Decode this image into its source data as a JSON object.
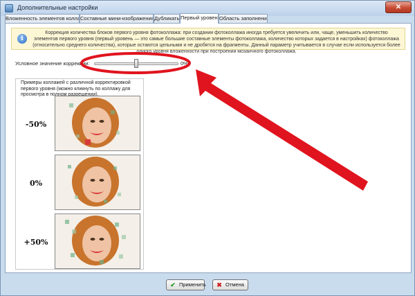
{
  "window": {
    "title": "Дополнительные настройки",
    "close_glyph": "✕"
  },
  "tabs": [
    {
      "label": "Вложенность элементов коллажа",
      "active": false
    },
    {
      "label": "Составные мини-изображения",
      "active": false
    },
    {
      "label": "Дубликаты",
      "active": false
    },
    {
      "label": "Первый уровень",
      "active": true
    },
    {
      "label": "Область заполнения",
      "active": false
    }
  ],
  "info": {
    "icon": "info-icon",
    "text": "Коррекция количества блоков первого уровня фотоколлажа: при создании фотоколлажа иногда требуется увеличить или, чаще, уменьшить количество элементов первого уровня (первый уровень — это самые большие составные элементы фотоколлажа, количество которых задается в настройках) фотоколлажа (относительно среднего количества), которые остаются цельными и не дробятся на фрагменты. Данный параметр учитывается в случае если используется более одного уровня вложенности при построении мозаичного фотоколлажа."
  },
  "slider": {
    "label": "Условное значение коррекции:",
    "value_text": "0%",
    "position": 0.5
  },
  "examples": {
    "text": "Примеры коллажей с различной корректировкой первого уровня (можно кликнуть по коллажу для просмотра в полном разрешении).",
    "rows": [
      {
        "label": "-50%"
      },
      {
        "label": "0%"
      },
      {
        "label": "+50%"
      }
    ]
  },
  "buttons": {
    "apply": {
      "label": "Применить",
      "icon": "check-icon"
    },
    "cancel": {
      "label": "Отмена",
      "icon": "cross-icon"
    }
  },
  "annotation": {
    "color": "#e0141e"
  },
  "colors": {
    "accent": "#3c6a9c",
    "info_bg": "#fdf7d6",
    "apply_icon": "#2a9a2a",
    "cancel_icon": "#cc2222"
  }
}
